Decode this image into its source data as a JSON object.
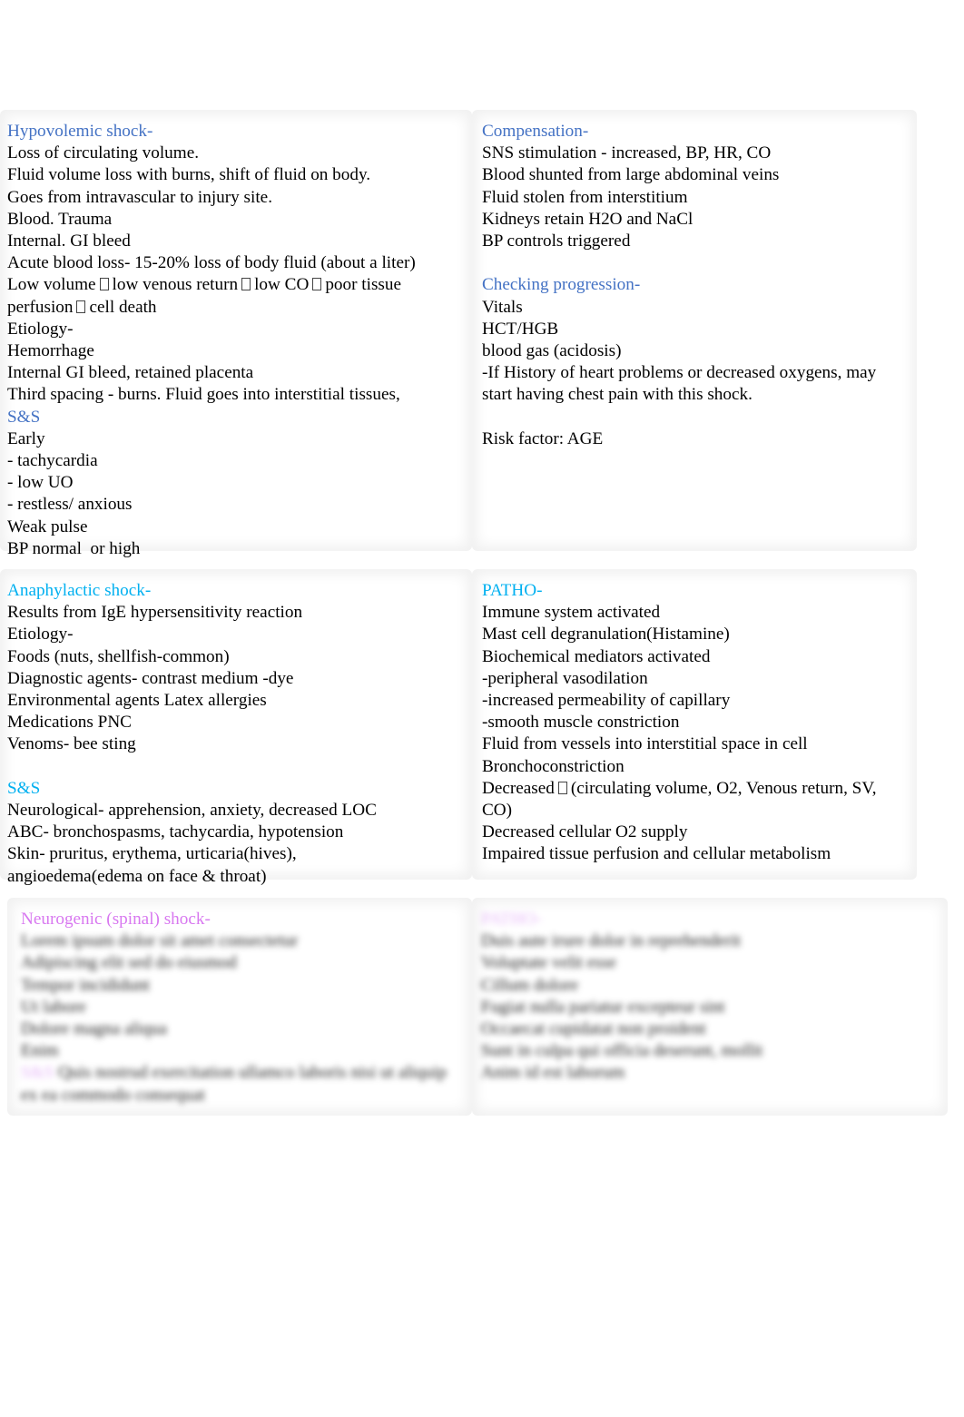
{
  "sections": [
    {
      "left": {
        "heading": "Hypovolemic shock-",
        "lines": [
          "Loss of circulating volume.",
          "Fluid volume loss with burns, shift of fluid on body.",
          "Goes from intravascular to injury site.",
          "Blood. Trauma",
          "Internal. GI bleed",
          "Acute blood loss- 15-20% loss of body fluid (about a liter)"
        ],
        "flow_line": {
          "parts": [
            "Low volume",
            "low venous return",
            "low CO",
            "poor tissue perfusion",
            "cell death"
          ]
        },
        "lines2": [
          "Etiology-",
          "Hemorrhage",
          "Internal GI bleed, retained placenta",
          "Third spacing - burns. Fluid goes into interstitial tissues,"
        ],
        "subheading": "S&S",
        "lines3": [
          "Early",
          "- tachycardia",
          "- low UO",
          "- restless/ anxious",
          "Weak pulse",
          "BP normal  or high"
        ]
      },
      "right": {
        "heading": "Compensation-",
        "lines": [
          "SNS stimulation - increased, BP, HR, CO",
          "Blood shunted from large abdominal veins",
          "Fluid stolen from interstitium",
          "Kidneys retain H2O and NaCl",
          "BP controls triggered"
        ],
        "subheading": "Checking progression-",
        "lines2": [
          "Vitals",
          "HCT/HGB",
          "blood gas (acidosis)",
          "-If History of heart problems or decreased oxygens, may start having chest pain with this shock."
        ],
        "risk": "Risk factor: AGE"
      }
    },
    {
      "left": {
        "heading": "Anaphylactic shock-",
        "lines": [
          "Results from IgE hypersensitivity reaction",
          "Etiology-",
          "Foods (nuts, shellfish-common)",
          "Diagnostic agents- contrast medium -dye",
          "Environmental agents Latex allergies",
          "Medications PNC",
          "Venoms- bee sting"
        ],
        "subheading": "S&S",
        "lines2": [
          "Neurological- apprehension, anxiety, decreased LOC",
          "ABC- bronchospasms, tachycardia, hypotension",
          "Skin- pruritus, erythema, urticaria(hives), angioedema(edema on face & throat)"
        ]
      },
      "right": {
        "heading": "PATHO-",
        "lines": [
          "Immune system activated",
          "Mast cell degranulation(Histamine)",
          "Biochemical mediators activated",
          "-peripheral vasodilation",
          "-increased permeability of capillary",
          "-smooth muscle constriction",
          "Fluid from vessels into interstitial space in cell",
          "Bronchoconstriction"
        ],
        "decreased_line": {
          "before": "Decreased",
          "after": "(circulating volume, O2, Venous return, SV, CO)"
        },
        "lines2": [
          "Decreased cellular O2 supply",
          "Impaired tissue perfusion and cellular metabolism"
        ]
      }
    },
    {
      "left": {
        "heading": "Neurogenic (spinal) shock-",
        "blurred_lines": [
          "Lorem ipsum dolor sit amet consectetur",
          "Adipiscing elit sed do eiusmod",
          "Tempor incididunt",
          "Ut labore",
          "Dolore magna aliqua",
          "Enim",
          "Quis nostrud exercitation ullamco laboris nisi ut aliquip",
          "ex ea commodo consequat"
        ],
        "blurred_tag": "S&S"
      },
      "right": {
        "heading": "PATHO-",
        "blurred_lines": [
          "Duis aute irure dolor in reprehenderit",
          "Voluptate velit esse",
          "Cillum dolore",
          "Fugiat nulla pariatur excepteur sint",
          "Occaecat cupidatat non proident",
          "Sunt in culpa qui officia deserunt, mollit",
          "Anim id est laborum"
        ]
      }
    }
  ]
}
